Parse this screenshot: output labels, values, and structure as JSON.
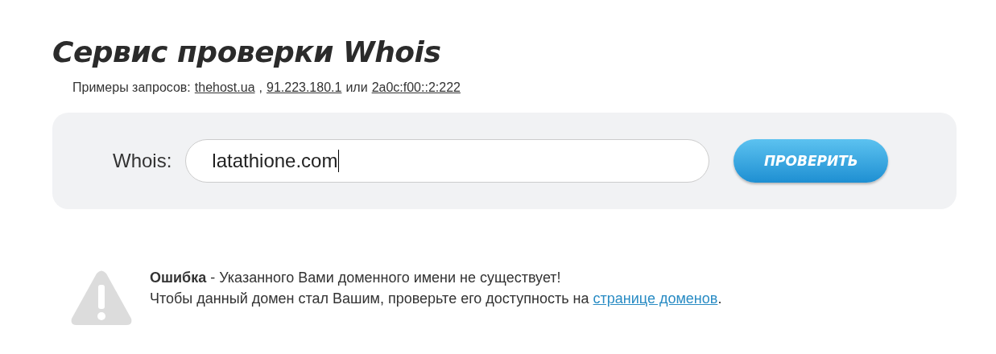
{
  "title": "Сервис проверки Whois",
  "examples": {
    "label": "Примеры запросов:",
    "items": [
      {
        "kind": "link",
        "text": "thehost.ua"
      },
      {
        "kind": "separator",
        "text": ","
      },
      {
        "kind": "link",
        "text": "91.223.180.1"
      },
      {
        "kind": "separator",
        "text": "или"
      },
      {
        "kind": "link",
        "text": "2a0c:f00::2:222"
      }
    ]
  },
  "search": {
    "label": "Whois:",
    "value": "latathione.com",
    "button": "ПРОВЕРИТЬ"
  },
  "error": {
    "message": "**Ошибка** - Указанного Вами доменного имени не существует!",
    "hint_before": "Чтобы данный домен стал Вашим, проверьте его доступность на ",
    "link": "странице доменов",
    "hint_after": "."
  }
}
